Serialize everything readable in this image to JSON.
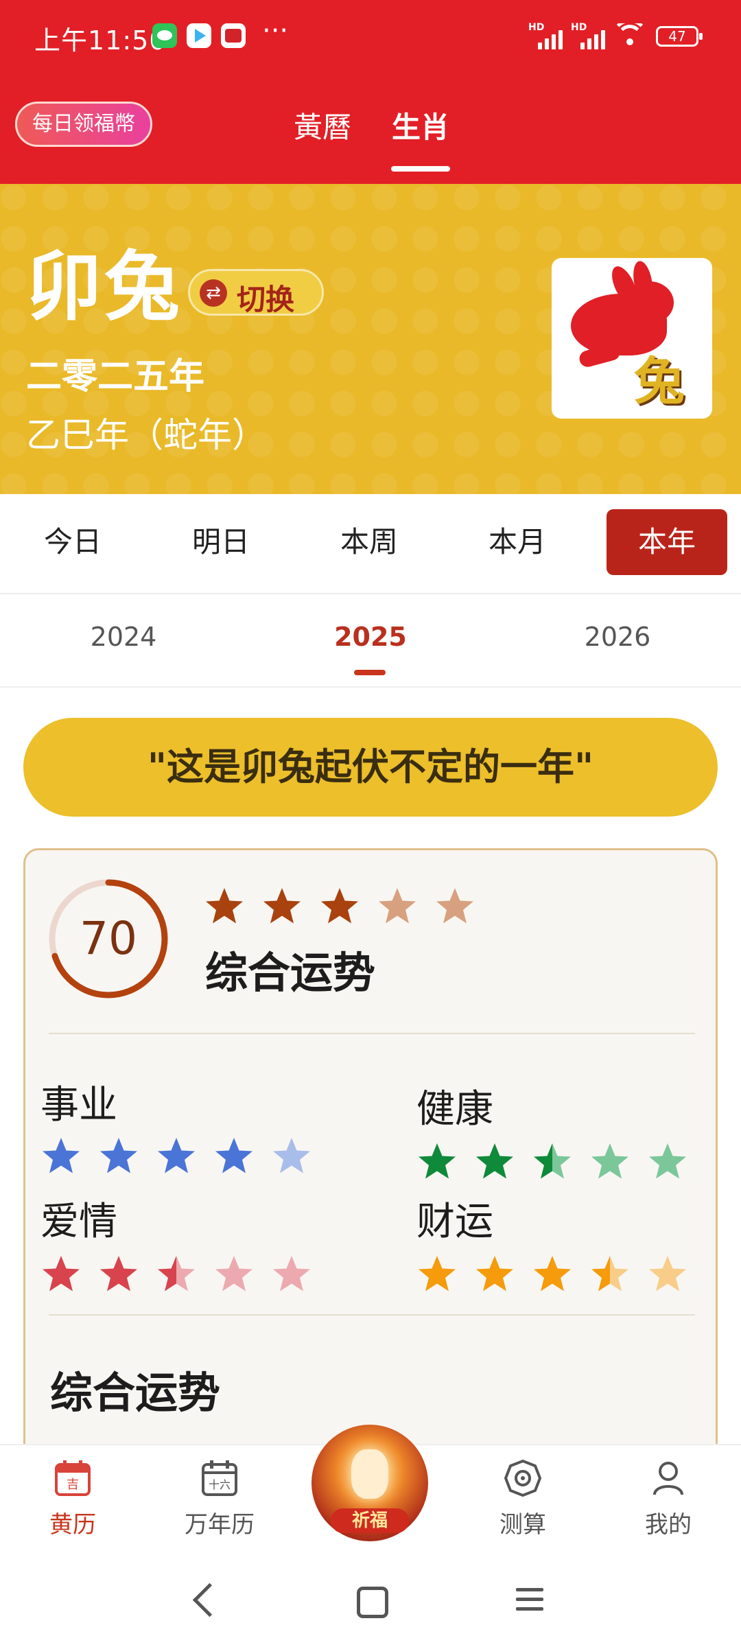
{
  "status_bar": {
    "time": "上午11:50",
    "more": "···",
    "signal_label_1": "HD",
    "signal_label_2": "HD",
    "battery": "47"
  },
  "header": {
    "coin_pill": "每日领福幣",
    "tabs": [
      {
        "label": "黃曆",
        "active": false
      },
      {
        "label": "生肖",
        "active": true
      }
    ]
  },
  "banner": {
    "zodiac": "卯兔",
    "switch_label": "切换",
    "switch_icon": "swap-arrows-icon",
    "year_cn": "二零二五年",
    "year_ganzhi": "乙巳年（蛇年）",
    "image_char": "兔"
  },
  "period_tabs": [
    {
      "label": "今日",
      "active": false
    },
    {
      "label": "明日",
      "active": false
    },
    {
      "label": "本周",
      "active": false
    },
    {
      "label": "本月",
      "active": false
    },
    {
      "label": "本年",
      "active": true
    }
  ],
  "year_tabs": [
    {
      "label": "2024",
      "active": false
    },
    {
      "label": "2025",
      "active": true
    },
    {
      "label": "2026",
      "active": false
    }
  ],
  "motto": "\"这是卯兔起伏不定的一年\"",
  "fortune": {
    "score": "70",
    "score_fraction": 0.7,
    "overall_label": "综合运势",
    "overall_stars": 3,
    "categories": [
      {
        "name": "事业",
        "stars": 4,
        "color": "#4a74d6",
        "light": "#a8bdea"
      },
      {
        "name": "健康",
        "stars": 2.5,
        "color": "#0e8a3a",
        "light": "#7bc79a"
      },
      {
        "name": "爱情",
        "stars": 2.5,
        "color": "#d8434e",
        "light": "#ecaab0"
      },
      {
        "name": "财运",
        "stars": 3.5,
        "color": "#f59b0c",
        "light": "#f7cd89"
      }
    ],
    "section_title": "综合运势"
  },
  "bottom_nav": [
    {
      "label": "黄历",
      "icon": "calendar-ji-icon",
      "active": true
    },
    {
      "label": "万年历",
      "icon": "calendar-sixteen-icon",
      "active": false
    },
    {
      "label": "测算",
      "icon": "bagua-icon",
      "active": false
    },
    {
      "label": "我的",
      "icon": "person-icon",
      "active": false
    }
  ],
  "center_button": {
    "label": "祈福"
  },
  "colors": {
    "brand_red": "#e21f26",
    "banner_gold": "#e9b929",
    "active_tab": "#b9241a",
    "score_ring": "#b3420f",
    "overall_star": "#a9420e",
    "overall_star_light": "#d7a17f"
  }
}
